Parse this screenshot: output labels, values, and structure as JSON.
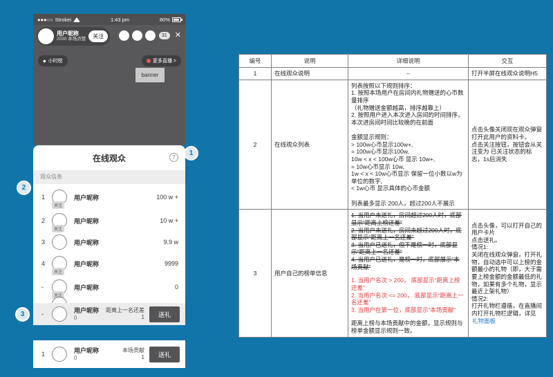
{
  "colors": {
    "page_bg": "#1175a9",
    "accent_blue": "#1076a8",
    "danger_red": "#e4393c",
    "link_blue": "#2779d8",
    "dark_ui": "#545456"
  },
  "phone": {
    "status_bar": {
      "signal": "●●●○○",
      "carrier": "Strokei",
      "time": "1:43 pm",
      "battery": "80%"
    },
    "header": {
      "username": "用户昵称",
      "likes": "2030 本场点赞",
      "follow_label": "关注",
      "viewer_count": "31",
      "close_label": "✕",
      "hour_rank_icon": "◆",
      "hour_rank_label": "小时榜",
      "more_live_label": "更多直播 >"
    },
    "banner_label": "banner",
    "panel": {
      "title": "在线观众",
      "help_icon": "?",
      "section_label": "观众信息",
      "rows": [
        {
          "rank": "1",
          "name": "用户昵称",
          "value": "100 w +",
          "follow_badge": "关注"
        },
        {
          "rank": "2",
          "name": "用户昵称",
          "value": "10 w +",
          "follow_badge": "关注"
        },
        {
          "rank": "3",
          "name": "用户昵称",
          "value": "9.9 w",
          "follow_badge": ""
        },
        {
          "rank": "4",
          "name": "用户昵称",
          "value": "9999",
          "follow_badge": "关注"
        },
        {
          "rank": "-",
          "name": "用户昵称",
          "value": "0",
          "follow_badge": "关注"
        }
      ],
      "self_row": {
        "rank": "-",
        "name": "用户昵称",
        "amount": "0",
        "gap_label": "距离上一名还差",
        "gap_value": "1",
        "gift_label": "送礼"
      }
    },
    "floating_row": {
      "rank": "1",
      "name": "用户昵称",
      "amount": "0",
      "contrib_label": "本场贡献",
      "contrib_value": "1",
      "gift_label": "送礼"
    }
  },
  "annotations": [
    "1",
    "2",
    "3"
  ],
  "table": {
    "headers": [
      "编号",
      "说明",
      "详细说明",
      "交互"
    ],
    "rows": [
      {
        "id": "1",
        "name": "在线观众说明",
        "detail": "–",
        "interaction": "打开半屏在线观众说明H5"
      },
      {
        "id": "2",
        "name": "在线观众列表",
        "detail": "列表按照以下规则排序：\n1. 按照本场用户在房间内礼物赠送的心币数量排序\n（礼物赠送金额越高，排序越靠上）\n2. 按照用户进入本次进入房间的时间排序，本次进房间时间比较晚的在前面\n\n金额显示规则：\n> 100w心币显示100w+,\n= 100w心币显示100w,\n10w < x < 100w心币 显示 10w+,\n= 10w心币显示 10w,\n1w < x < 10w心币显示 保留一位小数以w为单位的数字,\n< 1w心币 显示具体的心币金额\n\n列表最多显示 200人，超过200人不展示",
        "interaction": "点击头像关闭现在观众弹窗打开此用户的资料卡。\n点击关注按钮，按钮会从关注变为 已关注状态的标志，1s后消失"
      },
      {
        "id": "3",
        "name": "用户自己的榜单信息",
        "detail_struck": "1. 当用户未送礼，房间超过200人时，底部显示“距离上榜还差”\n2. 当用户未送礼，房间未超过200人时，底部显示“距离上一名还差”\n3. 当用户已送礼，但不是榜一时，底部显示“距离上一名还差”\n4. 当用户已送礼，是榜一时，底部展示“本场贡献”",
        "detail_red": "1. 当用户名次 > 200， 底部显示“距离上榜还差”\n2. 当用户名次 <= 200， 底部显示“距离上一名还差”\n3. 当用户在第一位，底部显示“本场贡献”",
        "detail_note": "距离上榜与本场贡献中的金额，显示规则与榜单金额显示规则一致。",
        "interaction": "点击头像，可以打开自己的用户卡片\n点击送礼。\n情况1:\n关闭在线观众弹窗，打开礼物，自动选中可以上榜的金额最小的礼物（即，大于需要上榜金额的金额最低的礼物，如果有多个礼物，显示最近上架礼物）\n情况2:\n打开礼物栏遵循，在直播间内打开礼物栏逻辑，详见 ",
        "link_label": "礼物面板"
      }
    ]
  }
}
